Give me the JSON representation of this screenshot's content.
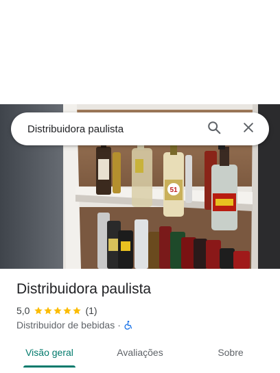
{
  "search": {
    "query": "Distribuidora paulista",
    "search_icon": "search-icon",
    "close_icon": "close-icon"
  },
  "photo": {
    "description_icon": "place-photo",
    "label_fifty_one": "51"
  },
  "place": {
    "title": "Distribuidora paulista",
    "rating": "5,0",
    "stars": 5,
    "reviews": "(1)",
    "category": "Distribuidor de bebidas",
    "separator": "·",
    "accessibility_icon": "wheelchair-icon"
  },
  "tabs": [
    {
      "label": "Visão geral",
      "active": true
    },
    {
      "label": "Avaliações",
      "active": false
    },
    {
      "label": "Sobre",
      "active": false
    }
  ],
  "colors": {
    "accent": "#00796b",
    "star": "#fbbc04",
    "accessibility": "#1a73e8"
  }
}
